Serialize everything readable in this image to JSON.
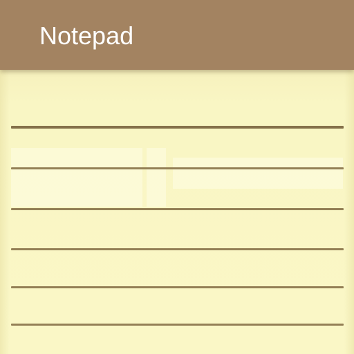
{
  "app": {
    "title": "Notepad"
  },
  "colors": {
    "header": "#a38361",
    "paper": "#f9f6c4",
    "rule": "#937f55",
    "title_text": "#ffffff"
  },
  "notepad": {
    "ruled_line_count": 6
  }
}
